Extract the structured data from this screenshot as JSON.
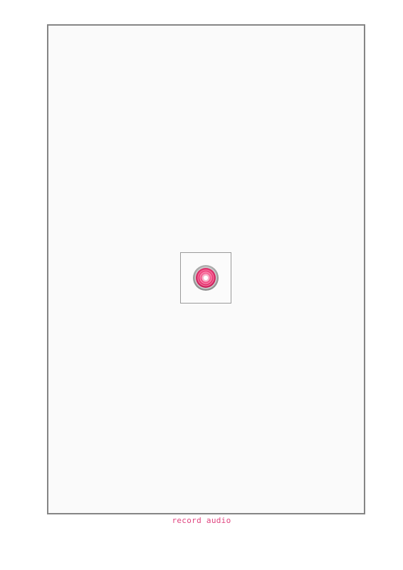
{
  "recorder": {
    "caption": "record audio",
    "caption_color": "#e0437e",
    "button_icon": "record-icon",
    "accent_color": "#e8346e"
  }
}
